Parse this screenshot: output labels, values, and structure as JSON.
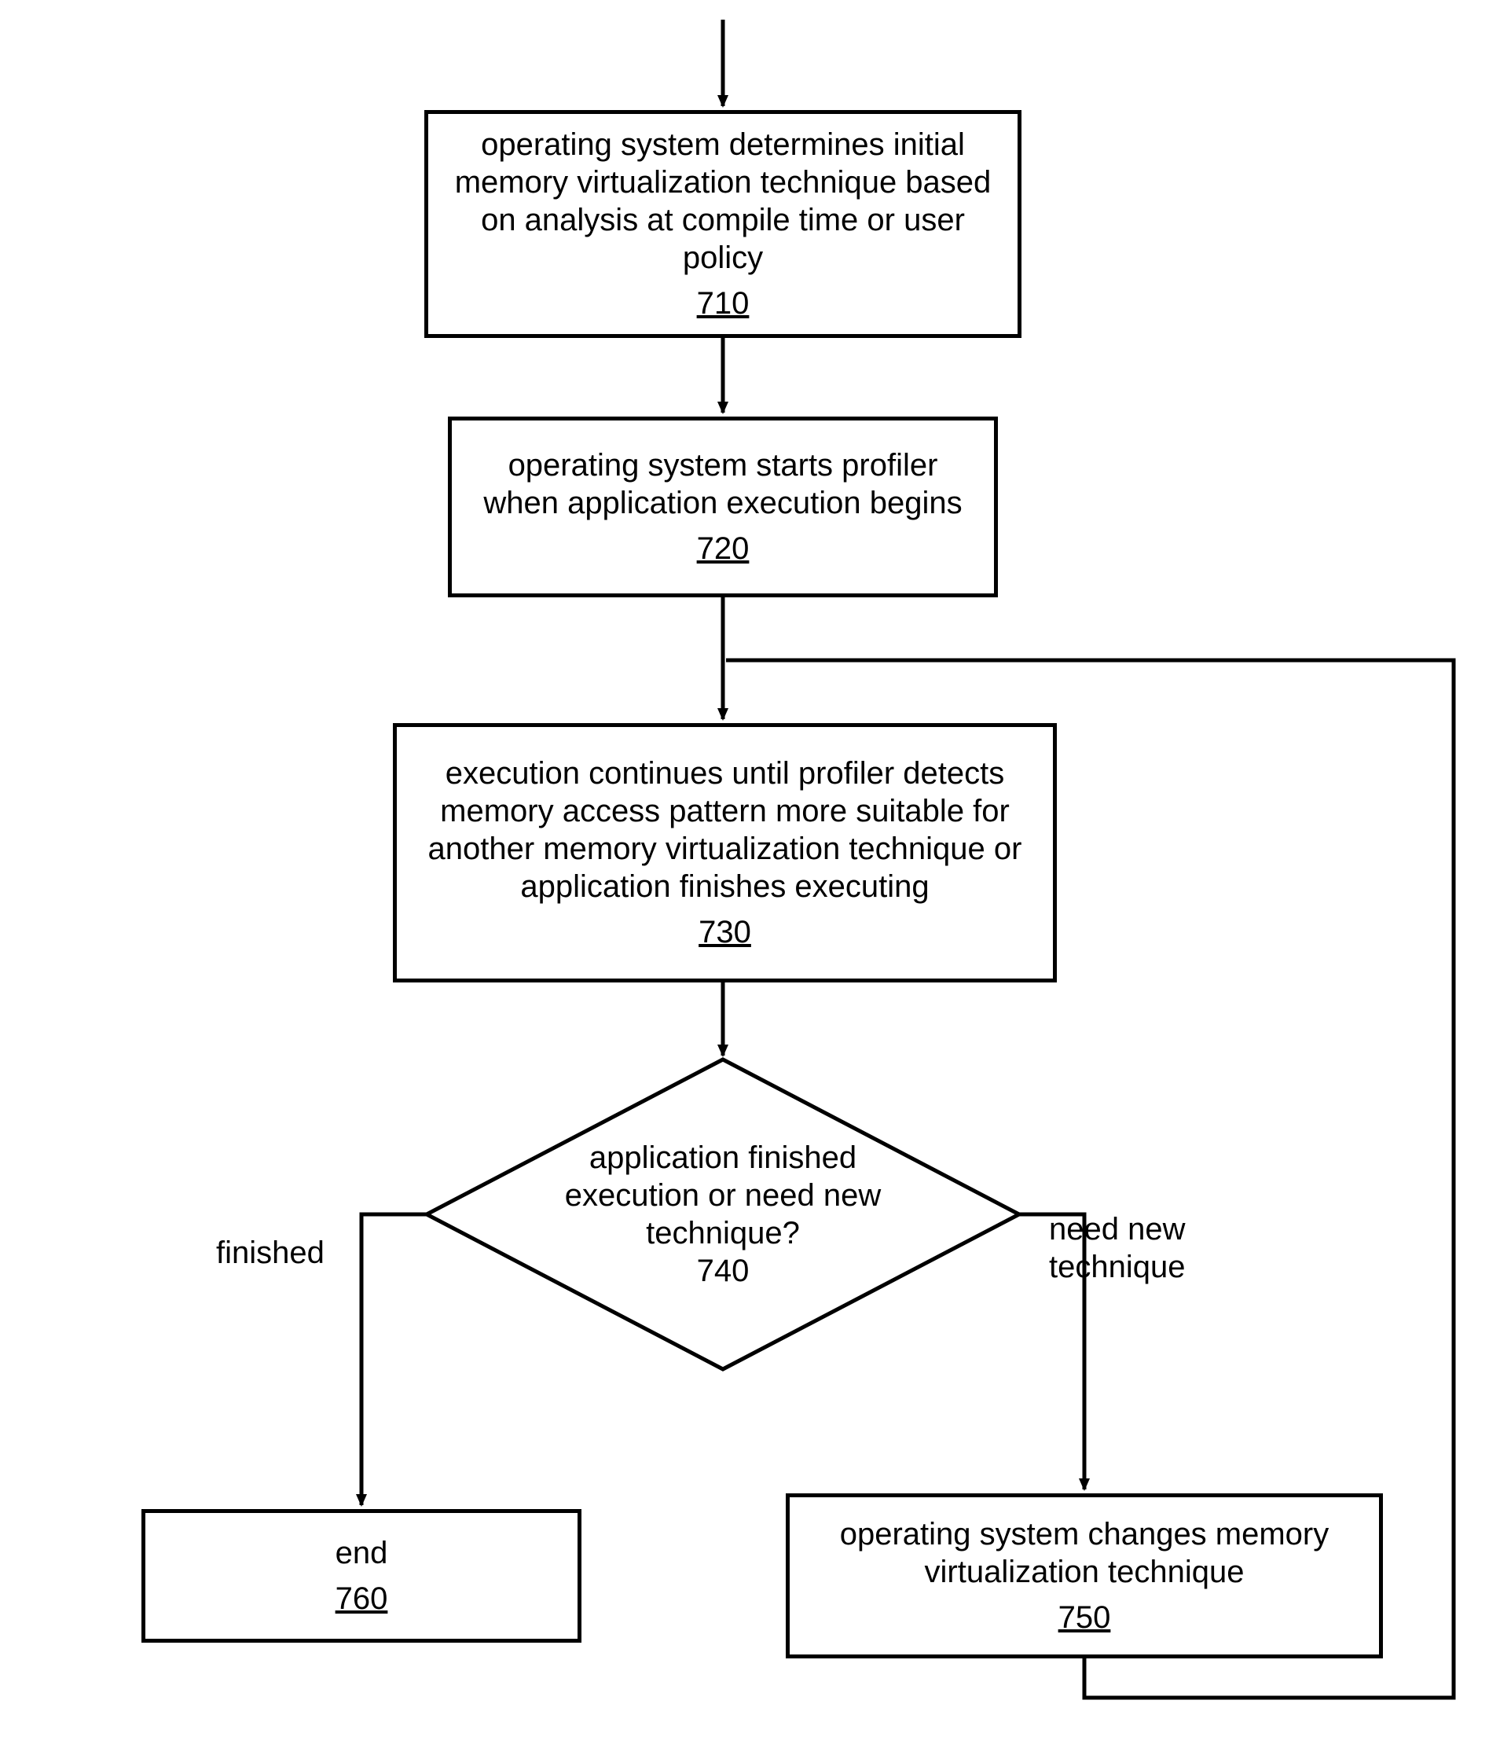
{
  "nodes": {
    "n710": {
      "text": "operating system determines initial memory virtualization technique based on analysis at compile time or user policy",
      "num": "710"
    },
    "n720": {
      "text": "operating system starts profiler when application execution begins",
      "num": "720"
    },
    "n730": {
      "text": "execution continues until profiler detects memory access pattern more suitable for another memory virtualization technique or application finishes executing",
      "num": "730"
    },
    "n740": {
      "text": "application finished execution or need new technique?",
      "num": "740"
    },
    "n750": {
      "text": "operating system changes memory virtualization technique",
      "num": "750"
    },
    "n760": {
      "text": "end",
      "num": "760"
    }
  },
  "labels": {
    "finished": "finished",
    "need_new": "need new technique"
  },
  "chart_data": {
    "type": "flowchart",
    "nodes": [
      {
        "id": "710",
        "type": "process",
        "text": "operating system determines initial memory virtualization technique based on analysis at compile time or user policy"
      },
      {
        "id": "720",
        "type": "process",
        "text": "operating system starts profiler when application execution begins"
      },
      {
        "id": "730",
        "type": "process",
        "text": "execution continues until profiler detects memory access pattern more suitable for another memory virtualization technique or application finishes executing"
      },
      {
        "id": "740",
        "type": "decision",
        "text": "application finished execution or need new technique?"
      },
      {
        "id": "750",
        "type": "process",
        "text": "operating system changes memory virtualization technique"
      },
      {
        "id": "760",
        "type": "terminator",
        "text": "end"
      }
    ],
    "edges": [
      {
        "from": "start",
        "to": "710"
      },
      {
        "from": "710",
        "to": "720"
      },
      {
        "from": "720",
        "to": "730"
      },
      {
        "from": "730",
        "to": "740"
      },
      {
        "from": "740",
        "to": "760",
        "label": "finished"
      },
      {
        "from": "740",
        "to": "750",
        "label": "need new technique"
      },
      {
        "from": "750",
        "to": "730"
      }
    ]
  }
}
